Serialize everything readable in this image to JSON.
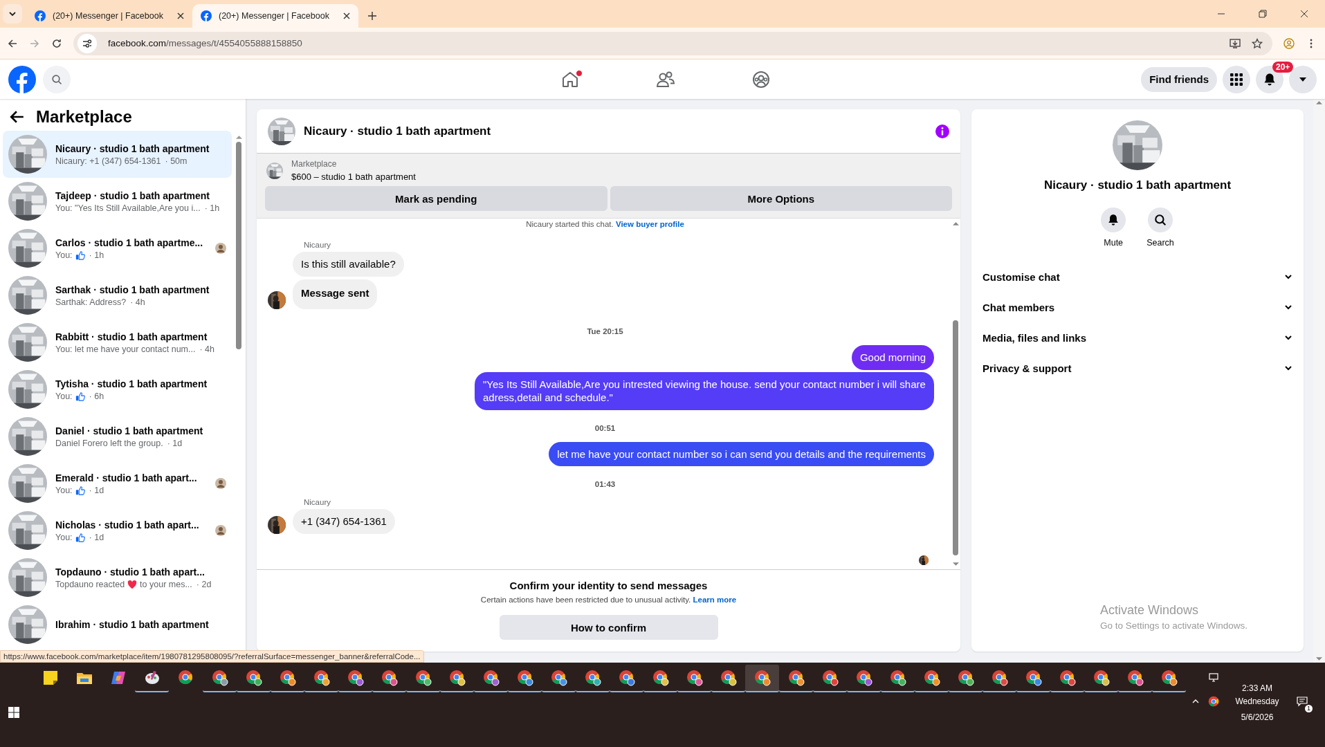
{
  "browser": {
    "tabs": [
      {
        "title": "(20+) Messenger | Facebook",
        "selected": false
      },
      {
        "title": "(20+) Messenger | Facebook",
        "selected": true
      }
    ],
    "url_host": "facebook.com",
    "url_path": "/messages/t/4554055888158850"
  },
  "topbar": {
    "nav": [
      {
        "kind": "home",
        "notification": true,
        "selected": false
      },
      {
        "kind": "friends",
        "notification": false,
        "selected": false
      },
      {
        "kind": "groups",
        "notification": false,
        "selected": false
      }
    ],
    "find_friends": "Find friends",
    "notification_badge": "20+"
  },
  "sidebar": {
    "title": "Marketplace",
    "conversations": [
      {
        "title": "Nicaury · studio 1 bath apartment",
        "preview": "Nicaury: +1 (347) 654-1361",
        "time": "· 50m",
        "selected": true,
        "seen": false
      },
      {
        "title": "Tajdeep · studio 1 bath apartment",
        "preview": "You: \"Yes Its Still Available,Are you i...",
        "time": "· 1h",
        "selected": false,
        "seen": false
      },
      {
        "title": "Carlos · studio 1 bath apartme...",
        "preview": "You:",
        "kind": "like",
        "time": "· 1h",
        "selected": false,
        "seen": true
      },
      {
        "title": "Sarthak · studio 1 bath apartment",
        "preview": "Sarthak: Address?",
        "time": "· 4h",
        "selected": false,
        "seen": false
      },
      {
        "title": "Rabbitt · studio 1 bath apartment",
        "preview": "You: let me have your contact num...",
        "time": "· 4h",
        "selected": false,
        "seen": false
      },
      {
        "title": "Tytisha · studio 1 bath apartment",
        "preview": "You:",
        "kind": "like",
        "time": "· 6h",
        "selected": false,
        "seen": false
      },
      {
        "title": "Daniel · studio 1 bath apartment",
        "preview": "Daniel Forero left the group.",
        "time": "· 1d",
        "selected": false,
        "seen": false
      },
      {
        "title": "Emerald · studio 1 bath apart...",
        "preview": "You:",
        "kind": "like",
        "time": "· 1d",
        "selected": false,
        "seen": true
      },
      {
        "title": "Nicholas · studio 1 bath apart...",
        "preview": "You:",
        "kind": "like",
        "time": "· 1d",
        "selected": false,
        "seen": true
      },
      {
        "title": "Topdauno · studio 1 bath apart...",
        "preview": "Topdauno reacted",
        "kind": "heart",
        "preview_after": "to your mes...",
        "time": "· 2d",
        "selected": false,
        "seen": false
      },
      {
        "title": "Ibrahim · studio 1 bath apartment",
        "selected": false,
        "seen": false
      }
    ]
  },
  "chat": {
    "title": "Nicaury · studio 1 bath apartment",
    "listing": {
      "label": "Marketplace",
      "price": "$600 – studio 1 bath apartment",
      "buttons": [
        "Mark as pending",
        "More Options"
      ]
    },
    "messages": [
      {
        "kind": "system",
        "text": "Nicaury started this chat.",
        "link": "View buyer profile"
      },
      {
        "kind": "incoming",
        "sender": "Nicaury",
        "bubbles": [
          {
            "text": "Is this still available?",
            "bold": false
          },
          {
            "text": "Message sent",
            "bold": true
          }
        ]
      },
      {
        "kind": "time",
        "text": "Tue 20:15"
      },
      {
        "kind": "outgoing",
        "bubbles": [
          {
            "text": "Good morning",
            "color": "#6f2cf2"
          },
          {
            "text": "\"Yes Its Still Available,Are you intrested viewing the house. send your contact number i will share adress,detail and schedule.\"",
            "color": "#553cf6"
          }
        ]
      },
      {
        "kind": "time",
        "text": "00:51"
      },
      {
        "kind": "outgoing",
        "bubbles": [
          {
            "text": "let me have your contact number so i can send you details and the requirements",
            "color": "#3a4cf4"
          }
        ]
      },
      {
        "kind": "time",
        "text": "01:43"
      },
      {
        "kind": "incoming",
        "sender": "Nicaury",
        "bubbles": [
          {
            "text": "+1 (347) 654-1361",
            "bold": false
          }
        ]
      }
    ],
    "confirm": {
      "title": "Confirm your identity to send messages",
      "text": "Certain actions have been restricted due to unusual activity.",
      "link": "Learn more",
      "button": "How to confirm"
    }
  },
  "details": {
    "title": "Nicaury · studio 1 bath apartment",
    "actions": [
      {
        "kind": "mute",
        "label": "Mute"
      },
      {
        "kind": "search",
        "label": "Search"
      }
    ],
    "sections": [
      {
        "label": "Customise chat",
        "expanded": false
      },
      {
        "label": "Chat members",
        "expanded": false
      },
      {
        "label": "Media, files and links",
        "expanded": false
      },
      {
        "label": "Privacy & support",
        "expanded": false
      }
    ]
  },
  "os_notice": {
    "title": "Activate Windows",
    "text": "Go to Settings to activate Windows."
  },
  "status_url": "https://www.facebook.com/marketplace/item/1980781295808095/?referralSurface=messenger_banner&referralCode...",
  "taskbar": {
    "apps": [
      {
        "kind": "notes",
        "running": false,
        "selected": false
      },
      {
        "kind": "folder",
        "running": false,
        "selected": false
      },
      {
        "kind": "copilot",
        "running": false,
        "selected": false
      },
      {
        "kind": "paint",
        "running": true,
        "selected": false
      },
      {
        "kind": "browser",
        "running": false,
        "selected": false
      },
      {
        "kind": "profile",
        "color": "#8a9aa8",
        "running": true,
        "selected": false
      },
      {
        "kind": "profile",
        "color": "#3fae5a",
        "running": true,
        "selected": false
      },
      {
        "kind": "profile",
        "color": "#f08a24",
        "running": true,
        "selected": false
      },
      {
        "kind": "profile",
        "color": "#f0a030",
        "running": true,
        "selected": false
      },
      {
        "kind": "profile",
        "color": "#9c5ad8",
        "running": true,
        "selected": false
      },
      {
        "kind": "profile",
        "color": "#e0508a",
        "running": true,
        "selected": false
      },
      {
        "kind": "profile",
        "color": "#4cba6a",
        "running": true,
        "selected": false
      },
      {
        "kind": "profile",
        "color": "#e0c040",
        "running": true,
        "selected": false
      },
      {
        "kind": "profile",
        "color": "#a060d0",
        "running": true,
        "selected": false
      },
      {
        "kind": "profile",
        "color": "#3a8ae0",
        "running": true,
        "selected": false
      },
      {
        "kind": "profile",
        "color": "#4a90e8",
        "running": true,
        "selected": false
      },
      {
        "kind": "profile",
        "color": "#30b0b0",
        "running": true,
        "selected": false
      },
      {
        "kind": "profile",
        "color": "#3a7ae0",
        "running": true,
        "selected": false
      },
      {
        "kind": "profile",
        "color": "#e0c048",
        "running": true,
        "selected": false
      },
      {
        "kind": "profile",
        "color": "#e05898",
        "running": true,
        "selected": false
      },
      {
        "kind": "profile",
        "color": "#d8c040",
        "running": true,
        "selected": false
      },
      {
        "kind": "profile",
        "color": "#f08a30",
        "running": true,
        "selected": true
      },
      {
        "kind": "profile",
        "color": "#f09030",
        "running": true,
        "selected": false
      },
      {
        "kind": "profile",
        "color": "#e04040",
        "running": true,
        "selected": false
      },
      {
        "kind": "profile",
        "color": "#9a58d8",
        "running": true,
        "selected": false
      },
      {
        "kind": "profile",
        "color": "#48b060",
        "running": true,
        "selected": false
      },
      {
        "kind": "profile",
        "color": "#f09028",
        "running": true,
        "selected": false
      },
      {
        "kind": "profile",
        "color": "#50b058",
        "running": true,
        "selected": false
      },
      {
        "kind": "profile",
        "color": "#e04848",
        "running": true,
        "selected": false
      },
      {
        "kind": "profile",
        "color": "#3a88e0",
        "running": true,
        "selected": false
      },
      {
        "kind": "profile",
        "color": "#e04444",
        "running": true,
        "selected": false
      },
      {
        "kind": "profile",
        "color": "#d8c048",
        "running": true,
        "selected": false
      },
      {
        "kind": "profile",
        "color": "#e05090",
        "running": true,
        "selected": false
      },
      {
        "kind": "profile",
        "color": "#f08830",
        "running": true,
        "selected": false
      }
    ],
    "time": "2:33 AM",
    "day": "Wednesday",
    "date": "5/6/2026",
    "notification_count": "1"
  }
}
